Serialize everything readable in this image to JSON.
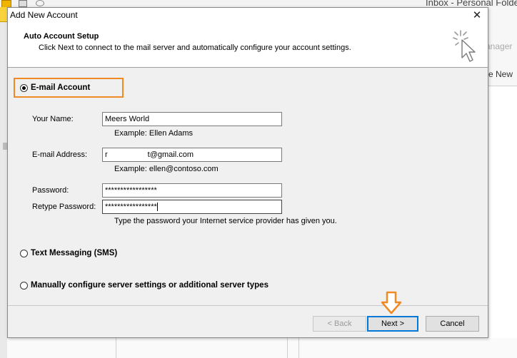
{
  "background": {
    "title_fragment": "Inbox - Personal Folders - Mic",
    "right_manager": "anager",
    "right_new": "e New"
  },
  "dialog": {
    "title": "Add New Account",
    "close_glyph": "✕",
    "header": {
      "title": "Auto Account Setup",
      "subtitle": "Click Next to connect to the mail server and automatically configure your account settings.",
      "icon": "wizard-cursor-icon"
    },
    "options": {
      "email_account": {
        "label": "E-mail Account",
        "selected": true
      },
      "text_messaging": {
        "label": "Text Messaging (SMS)",
        "selected": false
      },
      "manual": {
        "label": "Manually configure server settings or additional server types",
        "selected": false
      }
    },
    "fields": {
      "name": {
        "label": "Your Name:",
        "value": "Meers World",
        "example": "Example: Ellen Adams"
      },
      "email": {
        "label": "E-mail Address:",
        "value_start": "r",
        "value_end": "t@gmail.com",
        "example": "Example: ellen@contoso.com"
      },
      "password": {
        "label": "Password:",
        "value": "*****************"
      },
      "retype_password": {
        "label": "Retype Password:",
        "value": "*****************"
      },
      "password_hint": "Type the password your Internet service provider has given you."
    },
    "buttons": {
      "back": "< Back",
      "next": "Next >",
      "cancel": "Cancel"
    },
    "annotation_color": "#f08a24"
  }
}
